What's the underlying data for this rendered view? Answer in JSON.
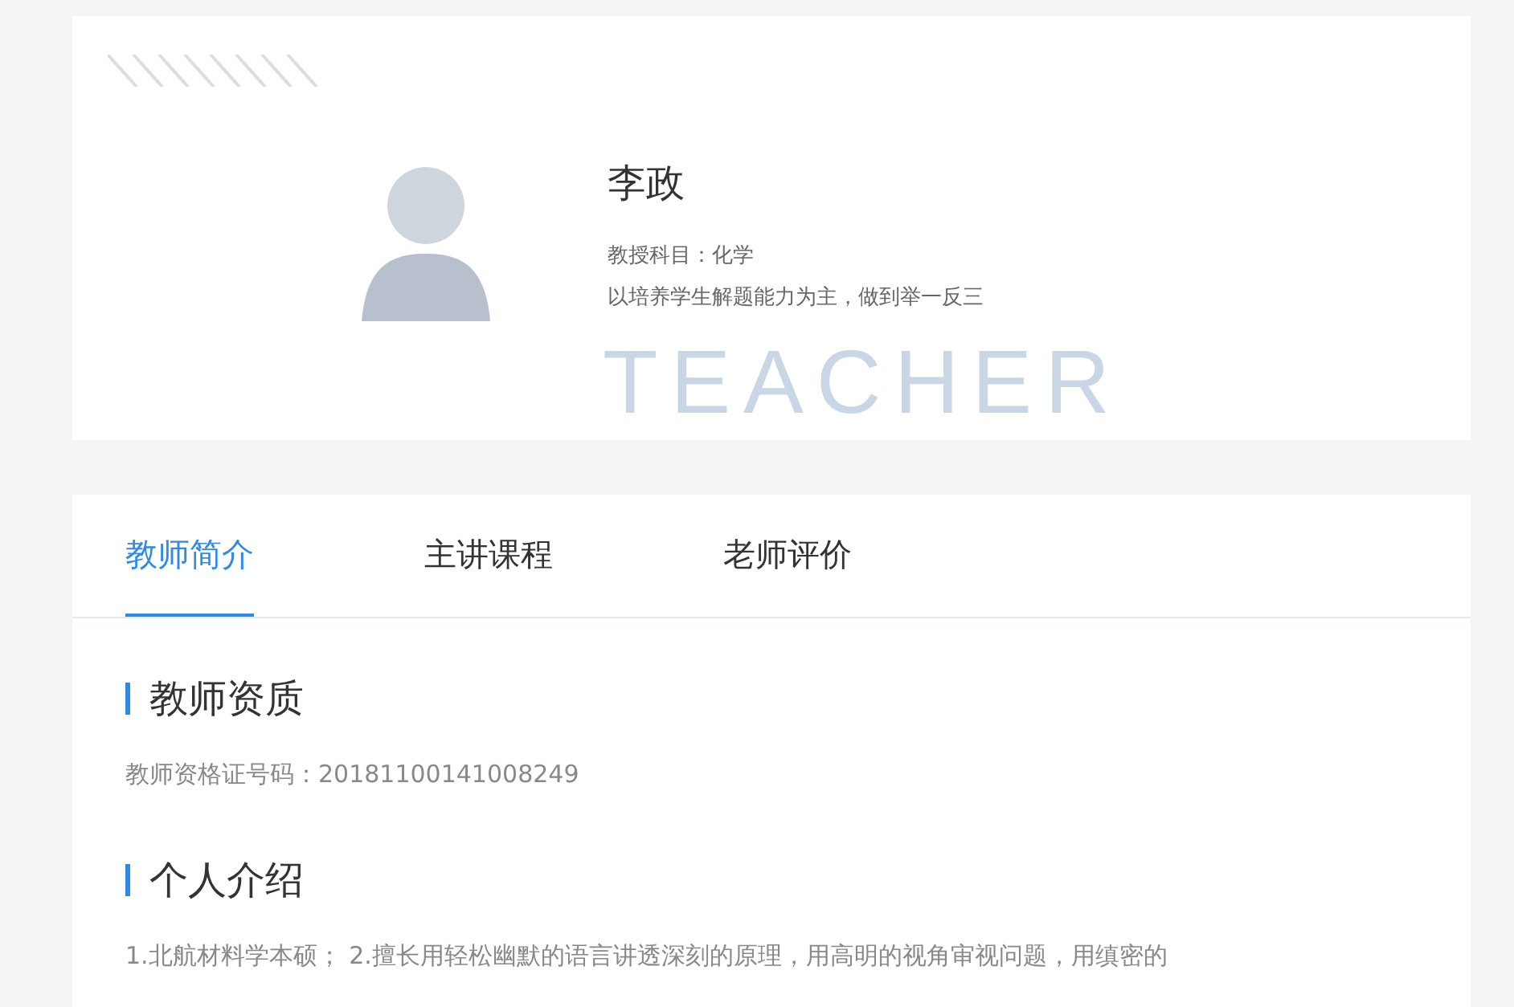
{
  "profile": {
    "background_word": "TEACHER",
    "name": "李政",
    "subject": "教授科目：化学",
    "motto": "以培养学生解题能力为主，做到举一反三"
  },
  "tabs": [
    {
      "label": "教师简介",
      "selected": true
    },
    {
      "label": "主讲课程",
      "selected": false
    },
    {
      "label": "老师评价",
      "selected": false
    }
  ],
  "sections": [
    {
      "title": "教师资质",
      "text": "教师资格证号码：20181100141008249"
    },
    {
      "title": "个人介绍",
      "text": "1.北航材料学本硕；  2.擅长用轻松幽默的语言讲透深刻的原理，用高明的视角审视问题，用缜密的"
    }
  ]
}
